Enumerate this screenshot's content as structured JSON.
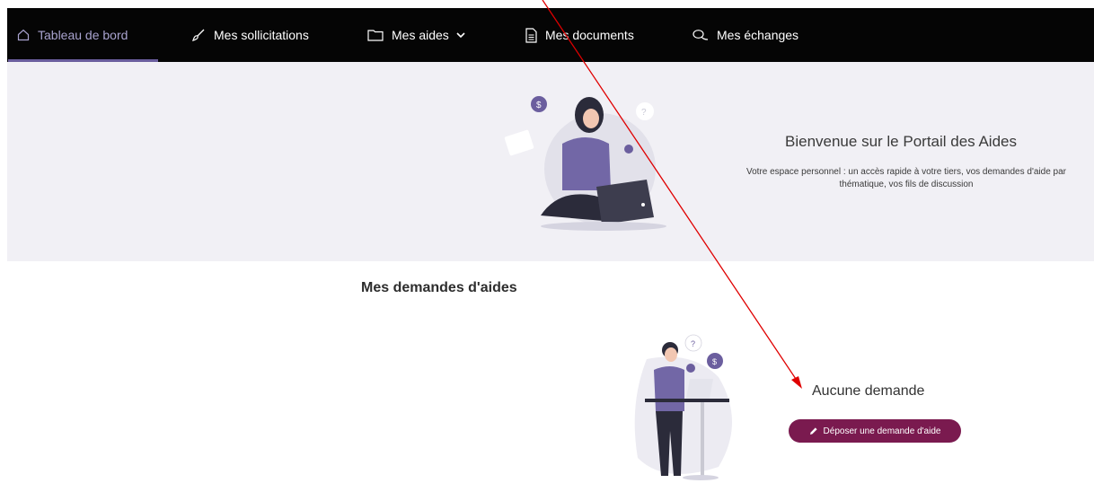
{
  "nav": {
    "items": [
      {
        "label": "Tableau de bord",
        "icon": "home-icon",
        "active": true
      },
      {
        "label": "Mes sollicitations",
        "icon": "brush-icon",
        "active": false
      },
      {
        "label": "Mes aides",
        "icon": "folder-icon",
        "active": false
      },
      {
        "label": "Mes documents",
        "icon": "document-icon",
        "active": false
      },
      {
        "label": "Mes échanges",
        "icon": "chat-icon",
        "active": false
      }
    ]
  },
  "hero": {
    "title": "Bienvenue sur le Portail des Aides",
    "text": "Votre espace personnel : un accès rapide à votre tiers, vos demandes d'aide par thématique, vos fils de discussion"
  },
  "requests": {
    "title": "Mes demandes d'aides",
    "empty_label": "Aucune demande",
    "deposit_label": "Déposer une demande d'aide"
  },
  "colors": {
    "nav_bg": "#050505",
    "hero_bg": "#f1f0f5",
    "accent": "#6b5e9e",
    "button": "#7a1a4f",
    "annotation_arrow": "#e00000"
  }
}
